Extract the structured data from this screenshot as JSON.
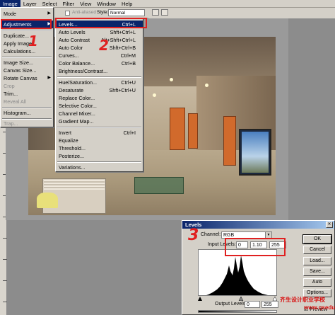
{
  "menubar": {
    "items": [
      "Image",
      "Layer",
      "Select",
      "Filter",
      "View",
      "Window",
      "Help"
    ]
  },
  "optionsbar": {
    "antialiased": "Anti-aliased",
    "style_label": "Style:",
    "style_value": "Normal"
  },
  "image_menu": {
    "items": [
      {
        "label": "Mode",
        "submenu": true
      },
      {
        "label": "Adjustments",
        "submenu": true
      },
      {
        "label": "Duplicate..."
      },
      {
        "label": "Apply Image..."
      },
      {
        "label": "Calculations..."
      },
      {
        "label": "Image Size..."
      },
      {
        "label": "Canvas Size..."
      },
      {
        "label": "Rotate Canvas",
        "submenu": true
      },
      {
        "label": "Crop"
      },
      {
        "label": "Trim..."
      },
      {
        "label": "Reveal All"
      },
      {
        "label": "Histogram..."
      },
      {
        "label": "Trap..."
      }
    ]
  },
  "adjustments_menu": {
    "items": [
      {
        "label": "Levels...",
        "shortcut": "Ctrl+L"
      },
      {
        "label": "Auto Levels",
        "shortcut": "Shft+Ctrl+L"
      },
      {
        "label": "Auto Contrast",
        "shortcut": "Alt+Shft+Ctrl+L"
      },
      {
        "label": "Auto Color",
        "shortcut": "Shft+Ctrl+B"
      },
      {
        "label": "Curves...",
        "shortcut": "Ctrl+M"
      },
      {
        "label": "Color Balance...",
        "shortcut": "Ctrl+B"
      },
      {
        "label": "Brightness/Contrast..."
      },
      {
        "label": "Hue/Saturation...",
        "shortcut": "Ctrl+U"
      },
      {
        "label": "Desaturate",
        "shortcut": "Shft+Ctrl+U"
      },
      {
        "label": "Replace Color..."
      },
      {
        "label": "Selective Color..."
      },
      {
        "label": "Channel Mixer..."
      },
      {
        "label": "Gradient Map..."
      },
      {
        "label": "Invert",
        "shortcut": "Ctrl+I"
      },
      {
        "label": "Equalize"
      },
      {
        "label": "Threshold..."
      },
      {
        "label": "Posterize..."
      },
      {
        "label": "Variations..."
      }
    ]
  },
  "annotations": {
    "step1": "1",
    "step2": "2",
    "step3": "3"
  },
  "levels_dialog": {
    "title": "Levels",
    "channel_label": "Channel:",
    "channel_value": "RGB",
    "input_label": "Input Levels:",
    "input_black": "0",
    "input_gamma": "1.10",
    "input_white": "255",
    "output_label": "Output Levels:",
    "output_black": "0",
    "output_white": "255",
    "buttons": [
      "OK",
      "Cancel",
      "Load...",
      "Save...",
      "Auto",
      "Options..."
    ],
    "preview_label": "Preview"
  },
  "watermark": {
    "line1": "齐生设计职业学校",
    "line2": "www.qsedu.net"
  },
  "colors": {
    "menu_bg": "#d4d0c8",
    "highlight": "#0a246a",
    "annotation_red": "#e02020"
  }
}
